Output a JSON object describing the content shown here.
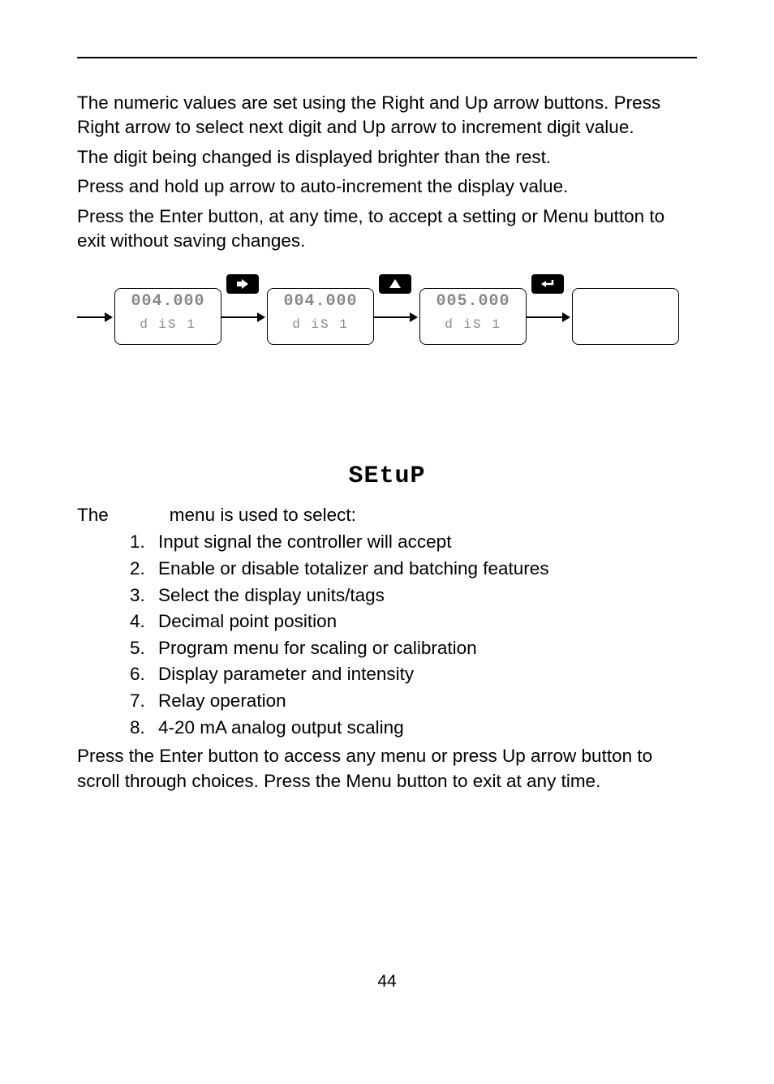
{
  "paragraphs": {
    "p1": "The numeric values are set using the Right and Up arrow buttons. Press Right arrow to select next digit and Up arrow to increment digit value.",
    "p2": "The digit being changed is displayed brighter than the rest.",
    "p3": "Press and hold up arrow to auto-increment the display value.",
    "p4": "Press the Enter button, at any time, to accept a setting or Menu button to exit without saving changes."
  },
  "diagram": {
    "boxes": [
      {
        "top": "004.000",
        "bot": "d iS  1"
      },
      {
        "top": "004.000",
        "bot": "d iS  1"
      },
      {
        "top": "005.000",
        "bot": "d iS  1"
      },
      {
        "top": "",
        "bot": ""
      }
    ],
    "buttons": [
      "right-arrow-icon",
      "up-arrow-icon",
      "enter-icon"
    ]
  },
  "setup": {
    "heading": "SEtuP",
    "intro_pre": "The",
    "intro_post": "menu is used to select:",
    "items": [
      "Input signal the controller will accept",
      "Enable or disable totalizer and batching features",
      "Select the display units/tags",
      "Decimal point position",
      "Program menu for scaling or calibration",
      "Display parameter and intensity",
      "Relay operation",
      "4-20 mA analog output scaling"
    ],
    "outro": "Press the Enter button to access any menu or press Up arrow button to scroll through choices. Press the Menu button to exit at any time."
  },
  "page_number": "44"
}
